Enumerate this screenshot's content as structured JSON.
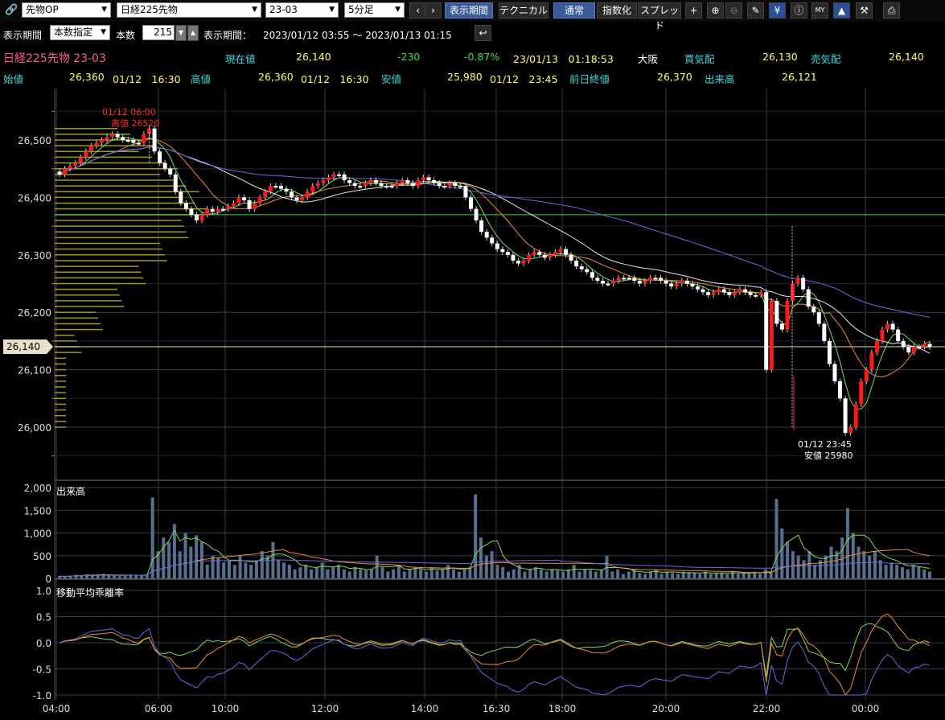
{
  "toolbar": {
    "market": "先物OP",
    "symbol": "日経225先物",
    "contract": "23-03",
    "interval": "5分足",
    "btn_period": "表示期間",
    "btn_technical": "テクニカル",
    "btn_normal": "通常",
    "btn_index": "指数化",
    "btn_spread": "スプレッド"
  },
  "period_bar": {
    "label1": "表示期間",
    "mode": "本数指定",
    "count_label": "本数",
    "count": "215",
    "label2": "表示期間：",
    "range": "2023/01/12 03:55 〜 2023/01/13 01:15"
  },
  "quote": {
    "name": "日経225先物 23-03",
    "current_label": "現在値",
    "current": "26,140",
    "change": "-230",
    "change_pct": "-0.87%",
    "datetime": "23/01/13　01:18:53",
    "exchange": "大阪",
    "bid_label": "買気配",
    "bid": "26,130",
    "ask_label": "売気配",
    "ask": "26,140"
  },
  "ohlc": {
    "open_label": "始値",
    "open": "26,360",
    "open_time": "01/12　16:30",
    "high_label": "高値",
    "high": "26,360",
    "high_time": "01/12　16:30",
    "low_label": "安値",
    "low": "25,980",
    "low_time": "01/12　23:45",
    "prev_label": "前日終値",
    "prev": "26,370",
    "volume_label": "出来高",
    "volume": "26,121"
  },
  "colors": {
    "up": "#ff1a1a",
    "down": "#ffffff",
    "ma_short": "#7cdc5c",
    "ma_mid": "#f08a3a",
    "ma_long": "#e8e8e8",
    "ma_longest": "#6a6ae0",
    "grid": "#3a3a4a",
    "prev_close": "#3fd13f",
    "price_profile": "#9a9a20"
  },
  "chart_data": [
    {
      "type": "candlestick",
      "title": "",
      "ylim": [
        25980,
        26560
      ],
      "y_ticks": [
        "26,500",
        "26,400",
        "26,300",
        "26,200",
        "26,100",
        "26,000"
      ],
      "current_price_label": "26,140",
      "high_annotation": {
        "time": "01/12 06:00",
        "text": "高値 26520"
      },
      "low_annotation": {
        "time": "01/12 23:45",
        "text": "安値 25980"
      },
      "prev_close": 26370,
      "close_series": [
        26440,
        26450,
        26455,
        26460,
        26470,
        26480,
        26490,
        26495,
        26500,
        26505,
        26510,
        26505,
        26500,
        26500,
        26495,
        26495,
        26510,
        26520,
        26480,
        26460,
        26450,
        26440,
        26410,
        26390,
        26380,
        26370,
        26360,
        26370,
        26380,
        26375,
        26380,
        26380,
        26385,
        26390,
        26400,
        26395,
        26380,
        26390,
        26400,
        26410,
        26420,
        26420,
        26415,
        26410,
        26400,
        26395,
        26400,
        26410,
        26420,
        26425,
        26430,
        26435,
        26440,
        26440,
        26430,
        26425,
        26420,
        26420,
        26425,
        26430,
        26425,
        26420,
        26420,
        26420,
        26425,
        26430,
        26425,
        26420,
        26430,
        26435,
        26430,
        26425,
        26420,
        26420,
        26425,
        26420,
        26420,
        26400,
        26380,
        26360,
        26340,
        26330,
        26320,
        26310,
        26305,
        26300,
        26290,
        26285,
        26290,
        26300,
        26305,
        26300,
        26295,
        26300,
        26305,
        26310,
        26300,
        26290,
        26280,
        26275,
        26270,
        26260,
        26255,
        26250,
        26250,
        26255,
        26260,
        26260,
        26260,
        26255,
        26250,
        26255,
        26260,
        26260,
        26255,
        26250,
        26245,
        26250,
        26255,
        26250,
        26245,
        26240,
        26235,
        26230,
        26235,
        26240,
        26235,
        26230,
        26235,
        26240,
        26235,
        26230,
        26230,
        26235,
        26100,
        26220,
        26180,
        26170,
        26220,
        26250,
        26260,
        26240,
        26210,
        26200,
        26180,
        26150,
        26110,
        26080,
        26050,
        25990,
        26000,
        26040,
        26080,
        26100,
        26130,
        26150,
        26170,
        26180,
        26170,
        26150,
        26140,
        26130,
        26140,
        26140,
        26145,
        26140
      ]
    },
    {
      "type": "bar",
      "title": "出来高",
      "ylim": [
        0,
        2000
      ],
      "y_ticks": [
        "2,000",
        "1,500",
        "1,000",
        "500",
        "0"
      ],
      "values": [
        50,
        40,
        60,
        80,
        70,
        90,
        60,
        80,
        100,
        70,
        60,
        50,
        80,
        90,
        70,
        60,
        70,
        1780,
        600,
        900,
        800,
        1200,
        600,
        1000,
        700,
        950,
        800,
        300,
        500,
        450,
        350,
        400,
        300,
        500,
        350,
        300,
        400,
        600,
        500,
        800,
        400,
        350,
        300,
        200,
        250,
        300,
        200,
        250,
        350,
        200,
        250,
        300,
        200,
        150,
        250,
        200,
        180,
        200,
        500,
        250,
        150,
        200,
        300,
        150,
        200,
        250,
        200,
        150,
        250,
        180,
        200,
        300,
        200,
        150,
        200,
        250,
        1850,
        900,
        500,
        600,
        300,
        250,
        150,
        200,
        300,
        150,
        200,
        250,
        200,
        150,
        200,
        180,
        150,
        200,
        300,
        150,
        200,
        180,
        150,
        200,
        500,
        150,
        200,
        100,
        150,
        200,
        120,
        100,
        150,
        200,
        100,
        150,
        120,
        100,
        150,
        130,
        120,
        100,
        150,
        100,
        120,
        130,
        100,
        150,
        100,
        120,
        130,
        150,
        100,
        200,
        150,
        1750,
        1100,
        800,
        600,
        500,
        400,
        600,
        300,
        400,
        500,
        700,
        600,
        900,
        1550,
        1000,
        700,
        600,
        500,
        600,
        400,
        300,
        350,
        300,
        250,
        200,
        300,
        250,
        200,
        150
      ]
    },
    {
      "type": "line",
      "title": "移動平均乖離率",
      "ylim": [
        -1.0,
        1.0
      ],
      "y_ticks": [
        "1.0",
        "0.5",
        "0.0",
        "-0.5",
        "-1.0"
      ],
      "x_ticks": [
        "04:00",
        "06:00",
        "10:00",
        "12:00",
        "14:00",
        "16:30",
        "18:00",
        "20:00",
        "22:00",
        "00:00"
      ]
    }
  ]
}
